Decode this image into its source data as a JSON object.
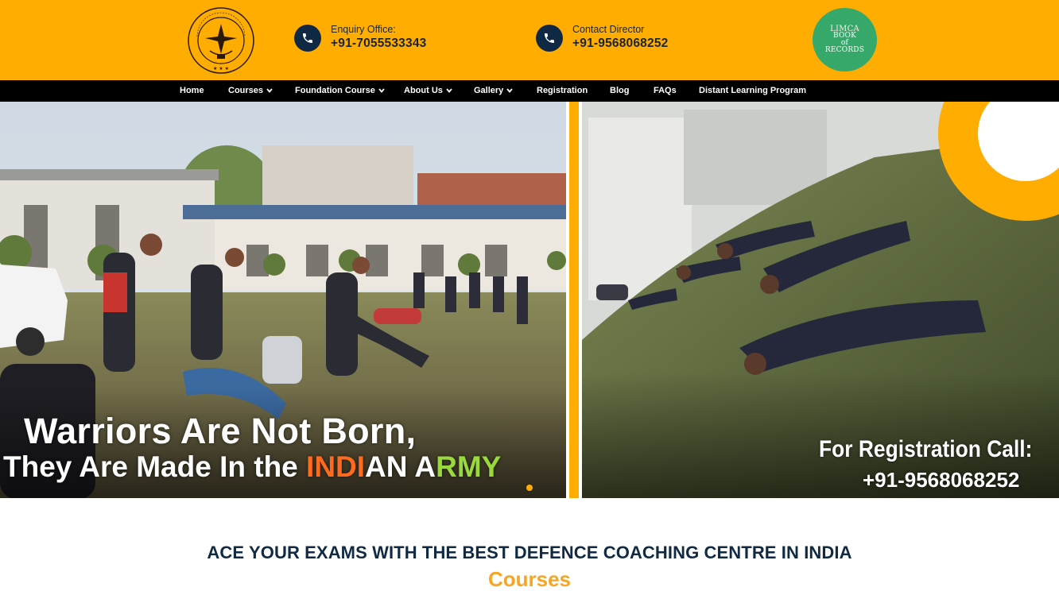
{
  "header": {
    "logo_alt": "The Sewaabhiyas Educational Center",
    "enquiry": {
      "label": "Enquiry Office:",
      "number": "+91-7055533343"
    },
    "director": {
      "label": "Contact Director",
      "number": "+91-9568068252"
    },
    "badge_lines": [
      "LIMCA",
      "BOOK",
      "of",
      "RECORDS"
    ]
  },
  "nav": {
    "items": [
      {
        "label": "Home",
        "dropdown": false
      },
      {
        "label": "Courses",
        "dropdown": true
      },
      {
        "label": "Foundation Course",
        "dropdown": true
      },
      {
        "label": "About Us",
        "dropdown": true
      },
      {
        "label": "Gallery",
        "dropdown": true
      },
      {
        "label": "Registration",
        "dropdown": false
      },
      {
        "label": "Blog",
        "dropdown": false
      },
      {
        "label": "FAQs",
        "dropdown": false
      },
      {
        "label": "Distant Learning Program",
        "dropdown": false
      }
    ]
  },
  "hero": {
    "tagline_line1": "Warriors Are Not Born,",
    "tagline_line2_a": "They Are Made In the ",
    "tagline_line2_b": "INDI",
    "tagline_line2_c": "AN A",
    "tagline_line2_d": "RMY",
    "registration_label": "For Registration Call:",
    "registration_number": "+91-9568068252"
  },
  "main": {
    "headline": "ACE YOUR EXAMS WITH THE BEST DEFENCE COACHING CENTRE IN INDIA",
    "section_title": "Courses"
  },
  "colors": {
    "brand_orange": "#ffad01",
    "navy": "#0f2843",
    "nav_bg": "#000000"
  }
}
